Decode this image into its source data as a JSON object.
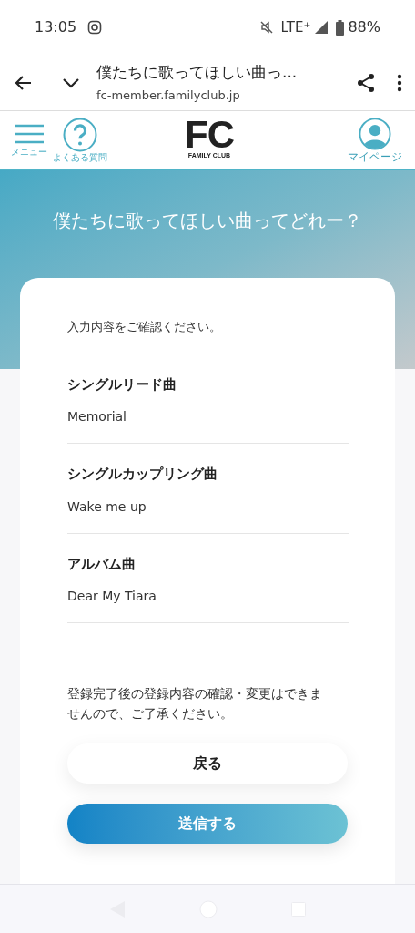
{
  "status_bar": {
    "time": "13:05",
    "network": "LTE⁺",
    "battery": "88%"
  },
  "browser": {
    "title": "僕たちに歌ってほしい曲っ...",
    "url": "fc-member.familyclub.jp"
  },
  "site_header": {
    "menu_label": "メニュー",
    "faq_label": "よくある質問",
    "logo": "FC",
    "logo_sub": "FAMILY CLUB",
    "mypage_label": "マイページ"
  },
  "hero": {
    "title": "僕たちに歌ってほしい曲ってどれー？"
  },
  "card": {
    "intro": "入力内容をご確認ください。",
    "fields": [
      {
        "label": "シングルリード曲",
        "value": "Memorial"
      },
      {
        "label": "シングルカップリング曲",
        "value": "Wake me up"
      },
      {
        "label": "アルバム曲",
        "value": "Dear My Tiara"
      }
    ],
    "notice": "登録完了後の登録内容の確認・変更はできませんので、ご了承ください。",
    "buttons": [
      {
        "kind": "secondary",
        "label": "戻る"
      },
      {
        "kind": "primary",
        "label": "送信する"
      }
    ]
  }
}
